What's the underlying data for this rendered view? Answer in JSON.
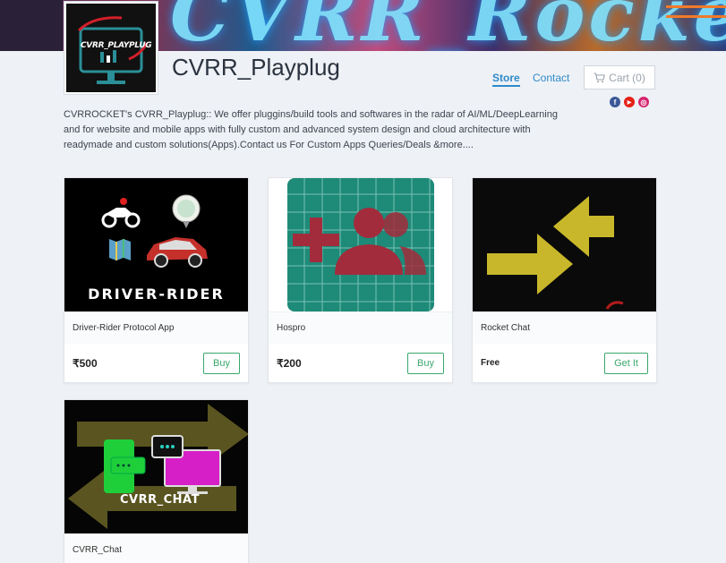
{
  "store": {
    "title": "CVRR_Playplug",
    "logo_text": "CVRR_PLAYPLUG",
    "banner_text": "CVRR_Rocket",
    "description": "CVRROCKET's CVRR_Playplug:: We offer pluggins/build tools and softwares in the radar of AI/ML/DeepLearning and for website and mobile apps with fully custom and advanced system design and cloud architecture with readymade and custom solutions(Apps).Contact us For Custom Apps Queries/Deals &more...."
  },
  "nav": {
    "store": "Store",
    "contact": "Contact",
    "cart": "Cart (0)"
  },
  "social": {
    "facebook": "f",
    "youtube": "▶",
    "instagram": "◎"
  },
  "products": [
    {
      "name": "Driver-Rider Protocol App",
      "price": "₹500",
      "button": "Buy",
      "image_caption": "DRIVER-RIDER"
    },
    {
      "name": "Hospro",
      "price": "₹200",
      "button": "Buy"
    },
    {
      "name": "Rocket Chat",
      "price": "Free",
      "button": "Get It"
    },
    {
      "name": "CVRR_Chat",
      "image_caption": "CVRR_CHAT"
    }
  ],
  "colors": {
    "accent": "#2f8ac9",
    "button": "#3aa76d"
  }
}
